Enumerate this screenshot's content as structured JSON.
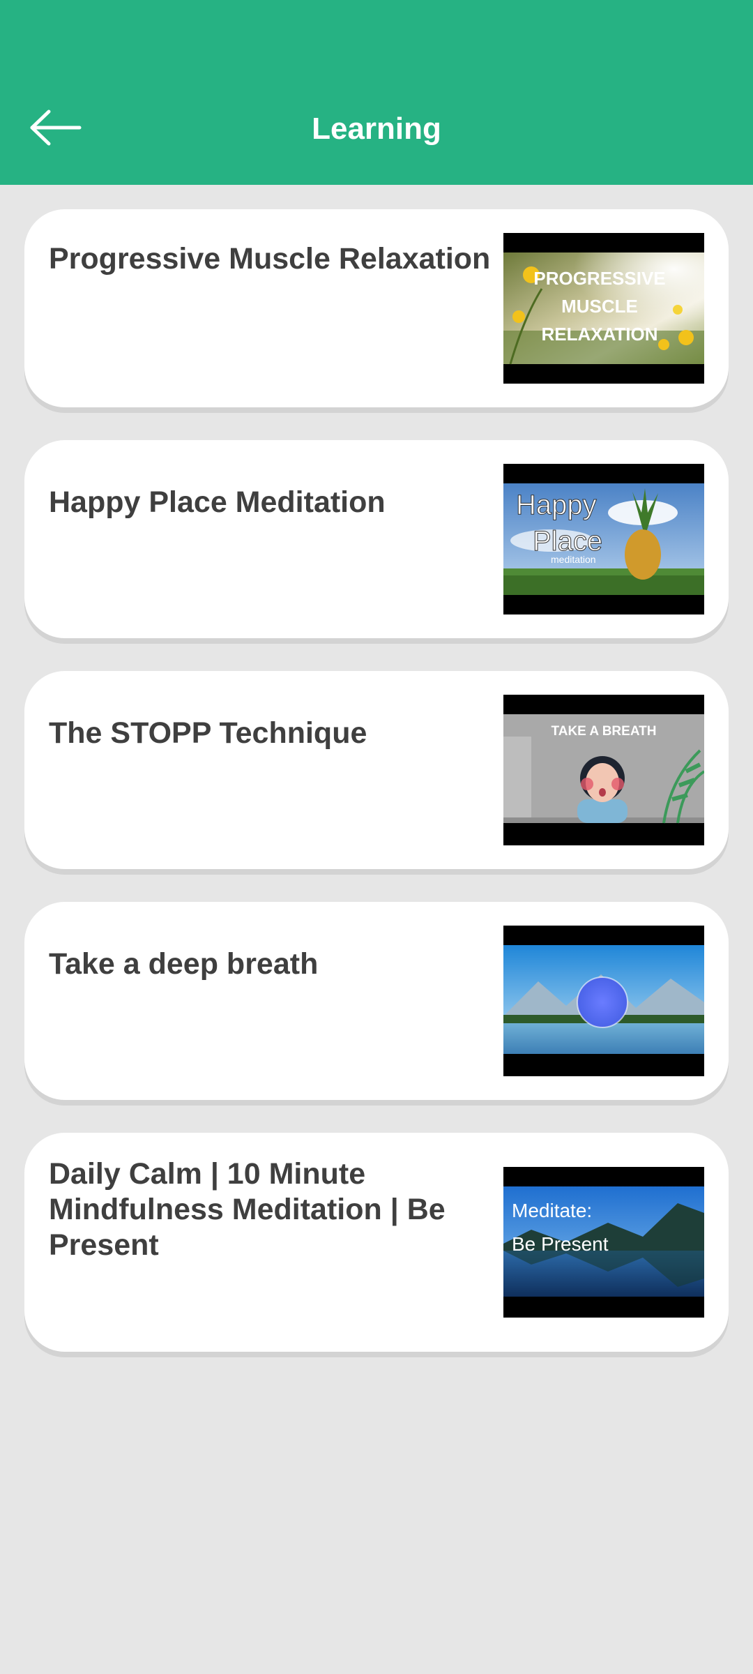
{
  "header": {
    "title": "Learning",
    "back_icon": "arrow-left-icon",
    "color": "#26b283"
  },
  "items": [
    {
      "title": "Progressive Muscle Relaxation",
      "thumb_text": [
        "PROGRESSIVE",
        "MUSCLE",
        "RELAXATION"
      ]
    },
    {
      "title": "Happy Place Meditation",
      "thumb_text": [
        "Happy",
        "Place",
        "meditation"
      ]
    },
    {
      "title": "The STOPP Technique",
      "thumb_text": [
        "TAKE A BREATH"
      ]
    },
    {
      "title": "Take a deep breath",
      "thumb_text": []
    },
    {
      "title": "Daily Calm | 10 Minute Mindfulness Meditation | Be Present",
      "thumb_text": [
        "Meditate:",
        "Be Present"
      ]
    }
  ]
}
